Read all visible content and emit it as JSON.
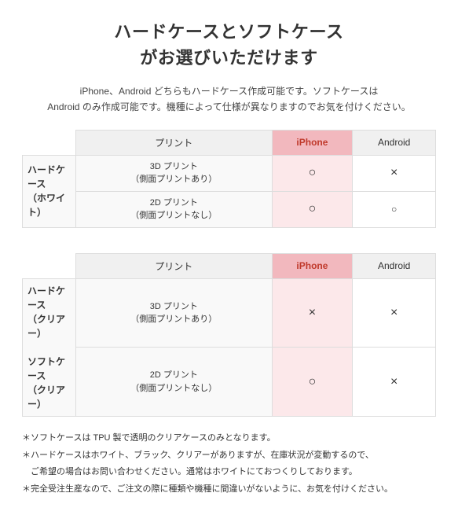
{
  "title": {
    "line1": "ハードケースとソフトケース",
    "line2": "がお選びいただけます"
  },
  "subtitle": "iPhone、Android どちらもハードケース作成可能です。ソフトケースは\nAndroid のみ作成可能です。機種によって仕様が異なりますのでお気を付けください。",
  "table1": {
    "row_header": "ハードケース\n（ホワイト）",
    "col_print": "プリント",
    "col_iphone": "iPhone",
    "col_android": "Android",
    "rows": [
      {
        "label": "3D プリント\n（側面プリントあり）",
        "iphone": "○",
        "android": "×"
      },
      {
        "label": "2D プリント\n（側面プリントなし）",
        "iphone": "○",
        "android": "○"
      }
    ]
  },
  "table2": {
    "row_header1": "ハードケース\n（クリアー）",
    "row_header2": "ソフトケース\n（クリアー）",
    "col_print": "プリント",
    "col_iphone": "iPhone",
    "col_android": "Android",
    "rows": [
      {
        "label": "3D プリント\n（側面プリントあり）",
        "iphone": "×",
        "android": "×"
      },
      {
        "label": "2D プリント\n（側面プリントなし）",
        "iphone": "○",
        "android": "×"
      }
    ]
  },
  "notes": [
    "＊ソフトケースは TPU 製で透明のクリアケースのみとなります。",
    "＊ハードケースはホワイト、ブラック、クリアーがありますが、在庫状況が変動するので、",
    "　ご希望の場合はお問い合わせください。通常はホワイトにておつくりしております。",
    "＊完全受注生産なので、ご注文の際に種類や機種に間違いがないように、お気を付けください。"
  ]
}
